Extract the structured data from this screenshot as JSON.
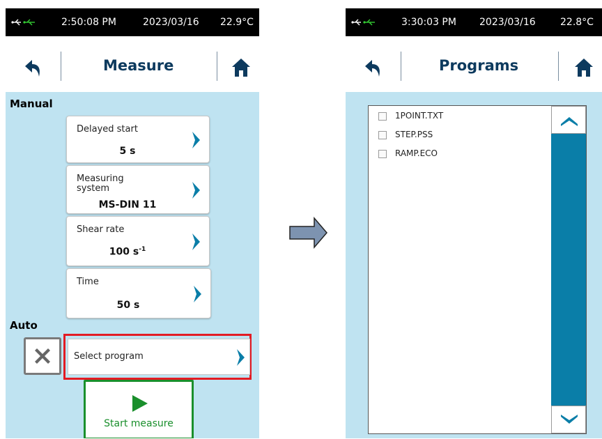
{
  "left_screen": {
    "status": {
      "time": "2:50:08 PM",
      "date": "2023/03/16",
      "temperature": "22.9°C"
    },
    "title": "Measure",
    "manual_label": "Manual",
    "auto_label": "Auto",
    "settings": [
      {
        "label": "Delayed start",
        "value": "5 s"
      },
      {
        "label": "Measuring system",
        "value": "MS-DIN 11"
      },
      {
        "label": "Shear rate",
        "value": "100 s",
        "value_sup": "-1"
      },
      {
        "label": "Time",
        "value": "50 s"
      }
    ],
    "program_button": "Select program",
    "start_button": "Start measure"
  },
  "right_screen": {
    "status": {
      "time": "3:30:03 PM",
      "date": "2023/03/16",
      "temperature": "22.8°C"
    },
    "title": "Programs",
    "files": [
      "1POINT.TXT",
      "STEP.PSS",
      "RAMP.ECO"
    ]
  },
  "icons": {
    "usb": "usb-icon",
    "back": "back-arrow-icon",
    "home": "home-icon",
    "chevron": "chevron-right-icon",
    "clear": "x-icon",
    "play": "play-icon",
    "flow": "right-arrow-icon",
    "scroll_up": "chevron-up-icon",
    "scroll_down": "chevron-down-icon"
  },
  "colors": {
    "title_text": "#0d3a5e",
    "background_panel": "#bfe3f1",
    "chevron": "#0a7ea8",
    "start_green": "#1a8f2c",
    "highlight_red": "#e31b23",
    "scrollbar": "#0a7ea8"
  }
}
